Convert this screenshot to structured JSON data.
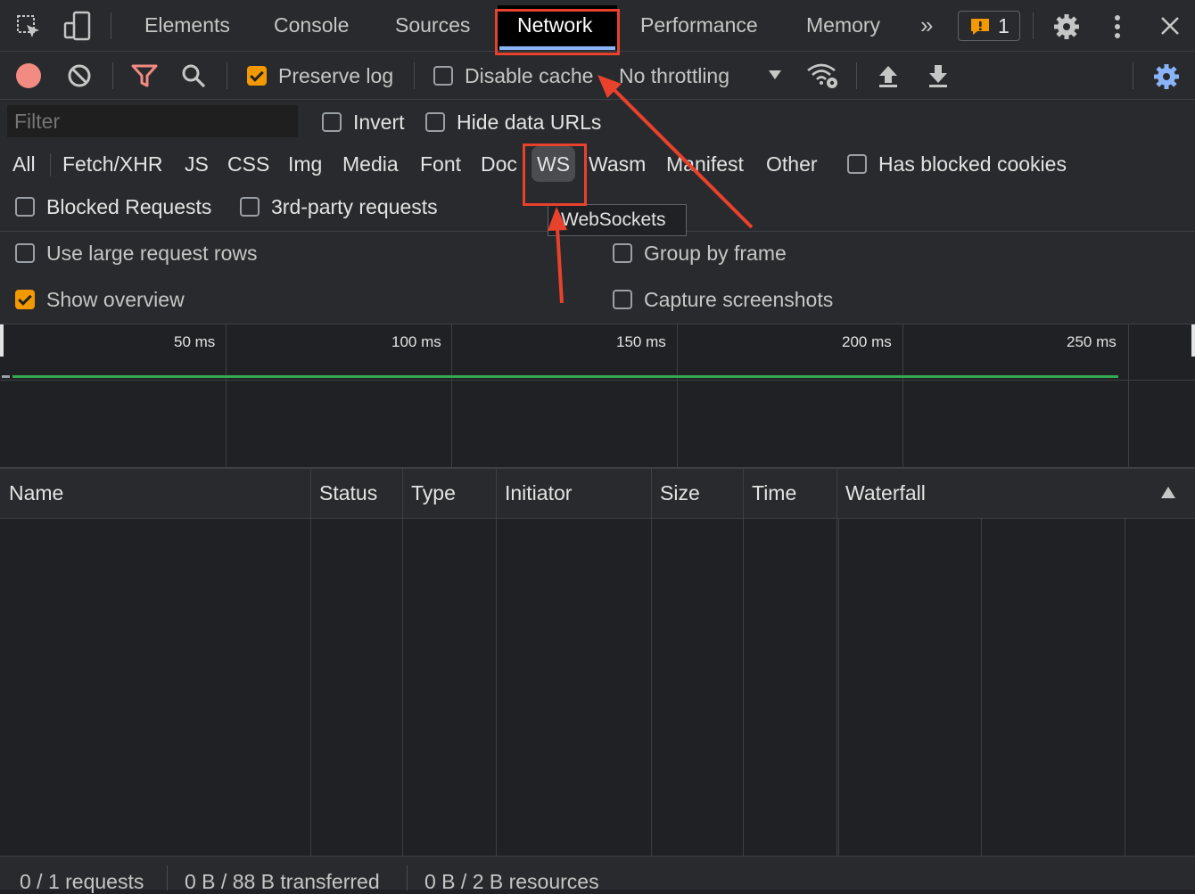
{
  "tabs": [
    {
      "label": "Elements"
    },
    {
      "label": "Console"
    },
    {
      "label": "Sources"
    },
    {
      "label": "Network",
      "active": true
    },
    {
      "label": "Performance"
    },
    {
      "label": "Memory"
    }
  ],
  "issues": {
    "count": "1"
  },
  "toolbar": {
    "preserve_log": "Preserve log",
    "preserve_log_checked": true,
    "disable_cache": "Disable cache",
    "disable_cache_checked": false,
    "throttling": "No throttling"
  },
  "filter": {
    "placeholder": "Filter",
    "invert": "Invert",
    "hide_data_urls": "Hide data URLs",
    "types": [
      "All",
      "Fetch/XHR",
      "JS",
      "CSS",
      "Img",
      "Media",
      "Font",
      "Doc",
      "WS",
      "Wasm",
      "Manifest",
      "Other"
    ],
    "selected_type": "WS",
    "has_blocked_cookies": "Has blocked cookies",
    "blocked_requests": "Blocked Requests",
    "third_party": "3rd-party requests",
    "tooltip": "WebSockets"
  },
  "settings": {
    "large_rows": "Use large request rows",
    "group_by_frame": "Group by frame",
    "show_overview": "Show overview",
    "show_overview_checked": true,
    "capture_screenshots": "Capture screenshots"
  },
  "overview": {
    "ticks": [
      "50 ms",
      "100 ms",
      "150 ms",
      "200 ms",
      "250 ms"
    ]
  },
  "table": {
    "columns": [
      "Name",
      "Status",
      "Type",
      "Initiator",
      "Size",
      "Time",
      "Waterfall"
    ]
  },
  "status": {
    "requests": "0 / 1 requests",
    "transferred": "0 B / 88 B transferred",
    "resources": "0 B / 2 B resources"
  },
  "colors": {
    "accent": "#f29900",
    "annotation": "#e8412c",
    "timeline": "#34a853",
    "record": "#f28b82"
  }
}
